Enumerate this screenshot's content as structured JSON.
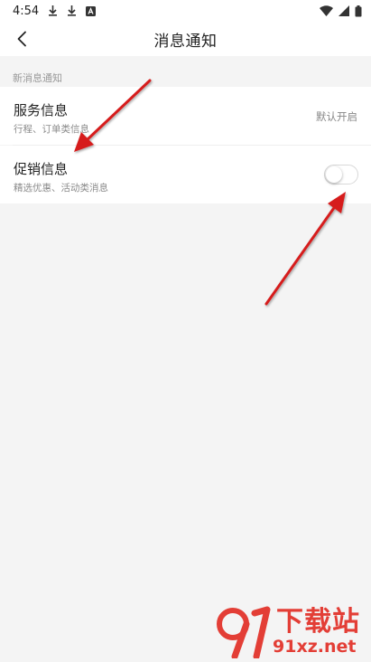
{
  "status_bar": {
    "time": "4:54",
    "icons": [
      "download-icon",
      "download-icon",
      "text-app-icon",
      "wifi-icon",
      "signal-icon",
      "battery-icon"
    ]
  },
  "header": {
    "title": "消息通知",
    "back_icon": "chevron-left-icon"
  },
  "section": {
    "label": "新消息通知"
  },
  "items": [
    {
      "title": "服务信息",
      "subtitle": "行程、订单类信息",
      "value": "默认开启"
    },
    {
      "title": "促销信息",
      "subtitle": "精选优惠、活动类消息",
      "toggle_on": false
    }
  ],
  "watermark": {
    "logo_text": "91",
    "brand": "下载站",
    "url": "91xz.net"
  },
  "colors": {
    "annotation_arrow": "#d61f1f",
    "watermark": "#e33e36",
    "background": "#f4f4f4"
  }
}
